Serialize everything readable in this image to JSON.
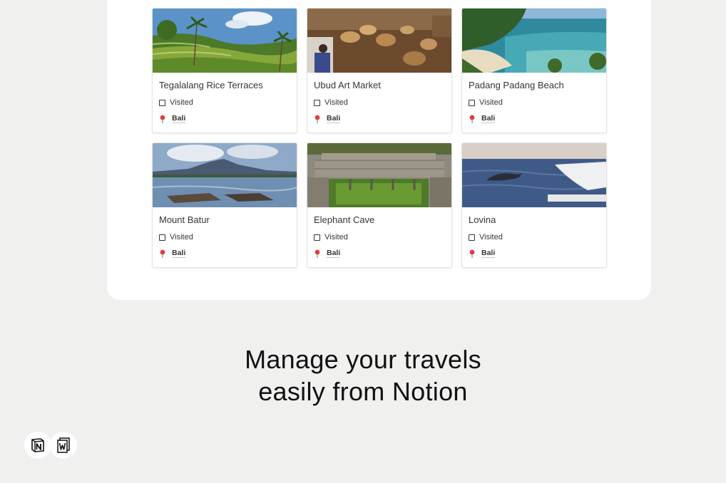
{
  "gallery": {
    "visited_label": "Visited",
    "cards": [
      {
        "title": "Tegalalang Rice Terraces",
        "location": "Bali",
        "image": "rice-terraces"
      },
      {
        "title": "Ubud Art Market",
        "location": "Bali",
        "image": "art-market"
      },
      {
        "title": "Padang Padang Beach",
        "location": "Bali",
        "image": "beach"
      },
      {
        "title": "Mount Batur",
        "location": "Bali",
        "image": "mountain-lake"
      },
      {
        "title": "Elephant Cave",
        "location": "Bali",
        "image": "temple-pool"
      },
      {
        "title": "Lovina",
        "location": "Bali",
        "image": "dolphin-sea"
      }
    ]
  },
  "headline": {
    "line1": "Manage your travels",
    "line2": "easily from Notion"
  },
  "logos": {
    "first": "notion-logo-icon",
    "second": "notion-w-logo-icon"
  },
  "colors": {
    "background": "#f0f0ef",
    "panel": "#ffffff",
    "pin": "#e03e3e"
  }
}
